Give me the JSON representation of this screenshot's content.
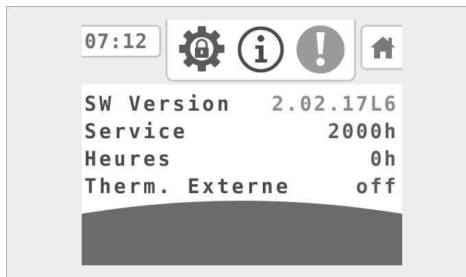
{
  "status_bar": {
    "time": "07:12"
  },
  "tabs": {
    "icons": [
      "settings-lock-icon",
      "info-icon",
      "alert-icon",
      "home-icon"
    ]
  },
  "info_rows": [
    {
      "label": "SW Version",
      "value": "2.02.17L6"
    },
    {
      "label": "Service",
      "value": "2000h"
    },
    {
      "label": "Heures",
      "value": "0h"
    },
    {
      "label": "Therm. Externe",
      "value": "off"
    }
  ],
  "colors": {
    "tab_border": "#c8c8c8",
    "icon_dark": "#5a5a5a",
    "alert_fill": "#9a9a9a",
    "bottom_band": "#6b6b6b",
    "text": "#4a4a4a"
  }
}
